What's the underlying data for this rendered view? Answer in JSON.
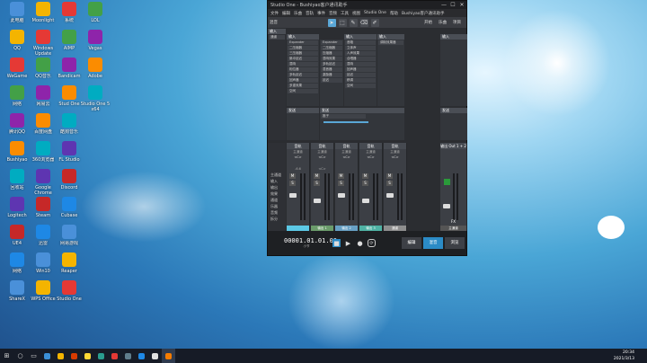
{
  "window": {
    "title": "Studio One - Bushiyao客户通讯助手",
    "min": "—",
    "max": "☐",
    "close": "✕",
    "menu": [
      "文件",
      "编辑",
      "乐曲",
      "音轨",
      "事件",
      "音频",
      "工具",
      "视图",
      "Studio One",
      "帮助",
      "Bushiyao客户通讯助手"
    ],
    "toolbar_labels": {
      "mixer": "混音",
      "start": "开始",
      "song": "乐曲",
      "project": "项目"
    }
  },
  "routing": {
    "section1": {
      "header": "输入",
      "subheader": "通道"
    },
    "col_a": {
      "header": "输入",
      "items": [
        "Expander",
        "二压缩器",
        "三压缩器",
        "脉冲延迟",
        "混响",
        "相位器",
        "多轨延迟",
        "回声器",
        "多重效果",
        "空间"
      ]
    },
    "col_b": {
      "items": [
        "Expander",
        "二压缩器",
        "压缩器",
        "混响效果",
        "多轨延迟",
        "混音器",
        "激励器",
        "延迟"
      ]
    },
    "col_c": {
      "header": "输入",
      "items": [
        "音箱",
        "立体声",
        "人声效果",
        "合唱器",
        "混响",
        "回声器",
        "延迟",
        "移调",
        "空间"
      ]
    },
    "col_d": {
      "header": "输入",
      "items": [
        "调制效果器"
      ]
    },
    "col_e": {
      "header": "输入",
      "items": []
    },
    "sends_label": "发送",
    "sends_value": "推子",
    "send_label_2": "发送",
    "send_right": "发送"
  },
  "channels": [
    {
      "name": "音轨",
      "sub": "主通道",
      "foot": "",
      "pan": "<C>",
      "gain": "-6.6",
      "color": "#5cc9e6"
    },
    {
      "name": "音轨",
      "sub": "主通道",
      "foot": "输出 1",
      "pan": "<C>",
      "gain": "<C>",
      "color": "#6b9c6b"
    },
    {
      "name": "音轨",
      "sub": "主通道",
      "foot": "输出 2",
      "pan": "<C>",
      "gain": "",
      "color": "#67a0c4"
    },
    {
      "name": "音轨",
      "sub": "主通道",
      "foot": "输出 3",
      "pan": "<C>",
      "gain": "",
      "color": "#4fb2a4"
    },
    {
      "name": "音轨",
      "sub": "主通道",
      "foot": "通道",
      "pan": "<C>",
      "gain": "",
      "color": "#8e8e8e"
    }
  ],
  "side_list": [
    "主通道",
    "输入",
    "输出",
    "效果",
    "通道",
    "乐器",
    "音频",
    "拆分"
  ],
  "master": {
    "name": "输出 Out 1 + 2",
    "sub": "主通道",
    "fx": "FX"
  },
  "transport": {
    "time": "00001.01.01.00",
    "sub": "小节",
    "tabs": [
      "编辑",
      "混音",
      "浏览"
    ]
  },
  "taskbar": {
    "time": "20:34",
    "date": "2021/3/13"
  },
  "desktop_icons": [
    "此电脑",
    "QQ",
    "WeGame",
    "网络",
    "腾讯QQ",
    "Bushiyao",
    "回收站",
    "Logitech",
    "UE4",
    "网络",
    "ShareX",
    "Moonlight",
    "Windows Update",
    "QQ音乐",
    "网易云",
    "百度网盘",
    "360浏览器",
    "Google Chrome",
    "Steam",
    "迅雷",
    "Win10",
    "WPS Office",
    "系统",
    "AIMP",
    "Bandicam",
    "Stud One",
    "酷狗音乐",
    "FL Studio",
    "Discord",
    "Cubase",
    "网易游戏",
    "Reaper",
    "Studio One",
    "LOL",
    "Vegas",
    "Adobe",
    "Studio One 5 x64"
  ]
}
